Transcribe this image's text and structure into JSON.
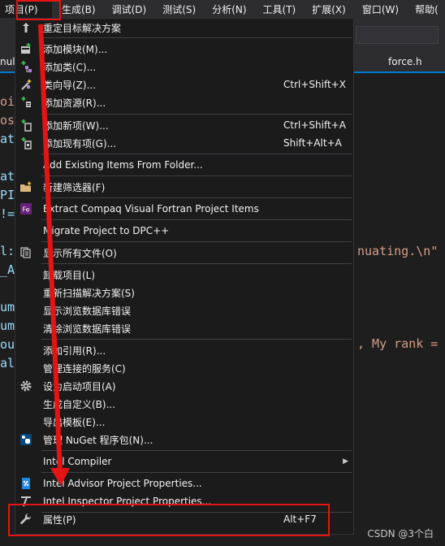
{
  "menubar": {
    "items": [
      {
        "label": "项目(P)"
      },
      {
        "label": "生成(B)"
      },
      {
        "label": "调试(D)"
      },
      {
        "label": "测试(S)"
      },
      {
        "label": "分析(N)"
      },
      {
        "label": "工具(T)"
      },
      {
        "label": "扩展(X)"
      },
      {
        "label": "窗口(W)"
      },
      {
        "label": "帮助("
      }
    ]
  },
  "editor": {
    "tab_left": "nuls",
    "tab_right": "force.h",
    "code_fragments": [
      "oi.",
      "ost",
      "at",
      "ata",
      "PI_",
      "!=",
      "l::",
      "_A",
      "um_",
      "um_",
      "out",
      "al",
      "nuating.\\n\"",
      ", My rank ="
    ]
  },
  "menu": {
    "items": [
      {
        "label": "重定目标解决方案",
        "shortcut": "",
        "icon": "retarget-icon"
      },
      {
        "label": "添加模块(M)...",
        "shortcut": "",
        "icon": "add-module-icon"
      },
      {
        "label": "添加类(C)...",
        "shortcut": "",
        "icon": "add-class-icon"
      },
      {
        "label": "类向导(Z)...",
        "shortcut": "Ctrl+Shift+X",
        "icon": "class-wizard-icon"
      },
      {
        "label": "添加资源(R)...",
        "shortcut": "",
        "icon": "add-resource-icon"
      },
      {
        "label": "添加新项(W)...",
        "shortcut": "Ctrl+Shift+A",
        "icon": "add-new-item-icon"
      },
      {
        "label": "添加现有项(G)...",
        "shortcut": "Shift+Alt+A",
        "icon": "add-existing-item-icon"
      },
      {
        "label": "Add Existing Items From Folder...",
        "shortcut": "",
        "icon": ""
      },
      {
        "label": "新建筛选器(F)",
        "shortcut": "",
        "icon": "new-filter-icon"
      },
      {
        "label": "Extract Compaq Visual Fortran Project Items",
        "shortcut": "",
        "icon": "fortran-icon"
      },
      {
        "label": "Migrate Project to DPC++",
        "shortcut": "",
        "icon": ""
      },
      {
        "label": "显示所有文件(O)",
        "shortcut": "",
        "icon": "show-all-files-icon"
      },
      {
        "label": "卸载项目(L)",
        "shortcut": "",
        "icon": ""
      },
      {
        "label": "重新扫描解决方案(S)",
        "shortcut": "",
        "icon": ""
      },
      {
        "label": "显示浏览数据库错误",
        "shortcut": "",
        "icon": ""
      },
      {
        "label": "清除浏览数据库错误",
        "shortcut": "",
        "icon": ""
      },
      {
        "label": "添加引用(R)...",
        "shortcut": "",
        "icon": ""
      },
      {
        "label": "管理连接的服务(C)",
        "shortcut": "",
        "icon": ""
      },
      {
        "label": "设为启动项目(A)",
        "shortcut": "",
        "icon": "gear-icon"
      },
      {
        "label": "生成自定义(B)...",
        "shortcut": "",
        "icon": ""
      },
      {
        "label": "导出模板(E)...",
        "shortcut": "",
        "icon": ""
      },
      {
        "label": "管理 NuGet 程序包(N)...",
        "shortcut": "",
        "icon": "nuget-icon"
      },
      {
        "label": "Intel Compiler",
        "shortcut": "",
        "icon": "",
        "submenu": "▶"
      },
      {
        "label": "Intel Advisor Project Properties...",
        "shortcut": "",
        "icon": "intel-advisor-icon"
      },
      {
        "label": "Intel Inspector Project Properties...",
        "shortcut": "",
        "icon": "intel-inspector-icon"
      },
      {
        "label": "属性(P)",
        "shortcut": "Alt+F7",
        "icon": "wrench-icon"
      }
    ]
  },
  "watermark": "CSDN @3个白",
  "colors": {
    "menu_bg": "#1b1b1c",
    "menubar_bg": "#2d2d30",
    "annotation_red": "#e51414",
    "accent": "#007acc"
  }
}
